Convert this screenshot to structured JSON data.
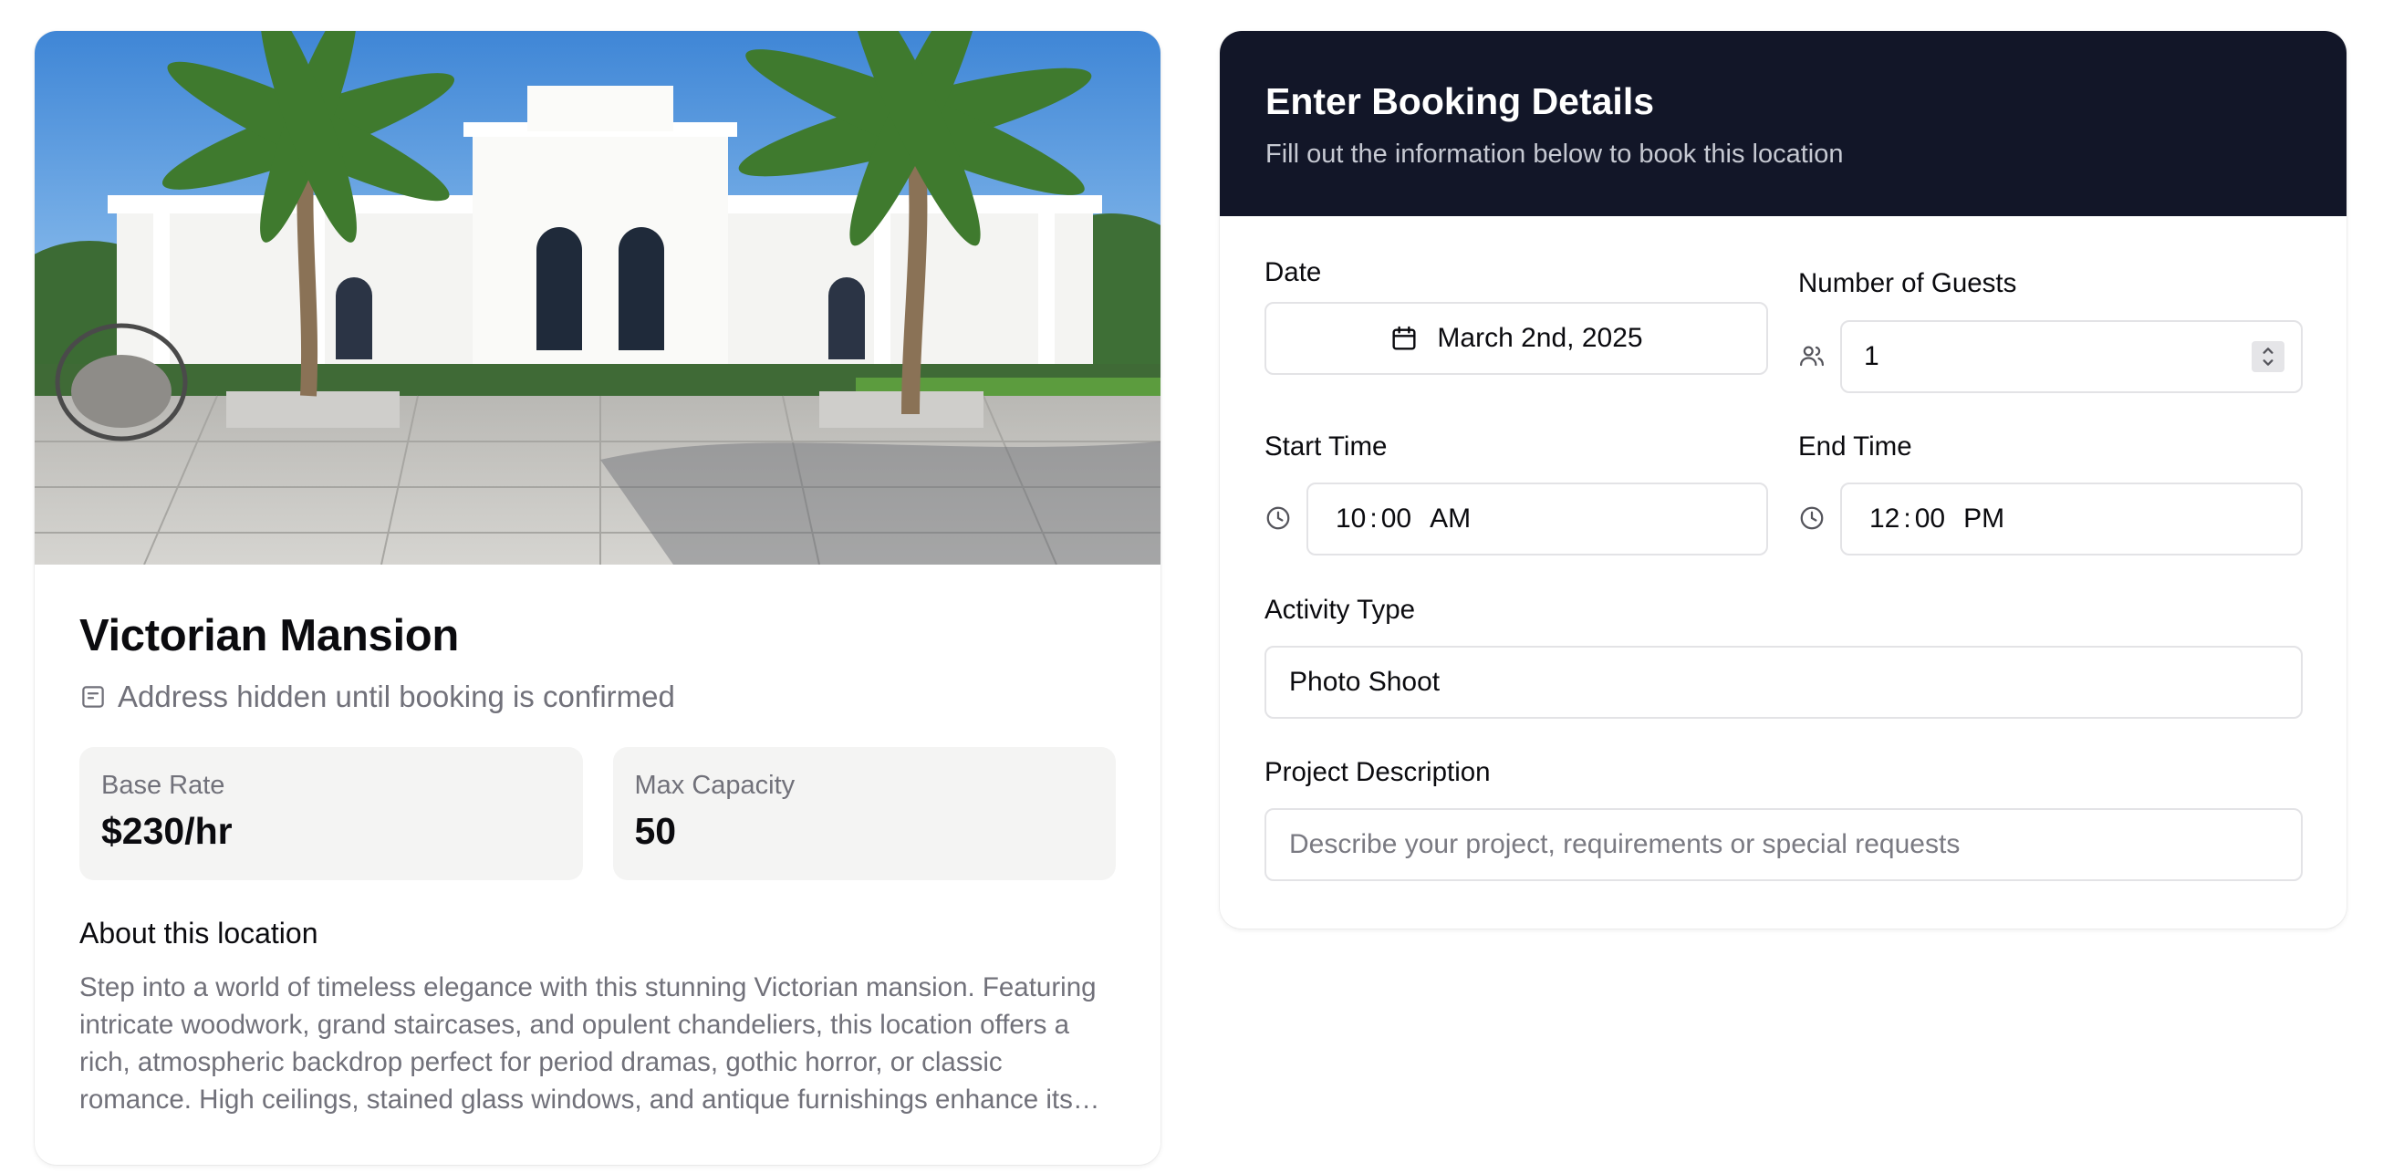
{
  "location": {
    "title": "Victorian Mansion",
    "address_note": "Address hidden until booking is confirmed",
    "stats": [
      {
        "label": "Base Rate",
        "value": "$230/hr"
      },
      {
        "label": "Max Capacity",
        "value": "50"
      }
    ],
    "about_heading": "About this location",
    "about_text": "Step into a world of timeless elegance with this stunning Victorian mansion. Featuring intricate woodwork, grand staircases, and opulent chandeliers, this location offers a rich, atmospheric backdrop perfect for period dramas, gothic horror, or classic romance. High ceilings, stained glass windows, and antique furnishings enhance its…"
  },
  "booking": {
    "title": "Enter Booking Details",
    "subtitle": "Fill out the information below to book this location",
    "date": {
      "label": "Date",
      "value": "March 2nd, 2025"
    },
    "guests": {
      "label": "Number of Guests",
      "value": "1"
    },
    "start_time": {
      "label": "Start Time",
      "hour": "10",
      "sep": ":",
      "minute": "00",
      "period": "AM"
    },
    "end_time": {
      "label": "End Time",
      "hour": "12",
      "sep": ":",
      "minute": "00",
      "period": "PM"
    },
    "activity": {
      "label": "Activity Type",
      "value": "Photo Shoot"
    },
    "description": {
      "label": "Project Description",
      "placeholder": "Describe your project, requirements or special requests"
    }
  },
  "icons": {
    "address": "building-icon",
    "date": "calendar-icon",
    "guests": "users-icon",
    "time": "clock-icon",
    "stepper": "chevron-up-down-icon"
  },
  "colors": {
    "header_bg": "#121628",
    "stat_bg": "#f4f4f3",
    "muted_text": "#71717a",
    "border": "#e3e3e6"
  }
}
